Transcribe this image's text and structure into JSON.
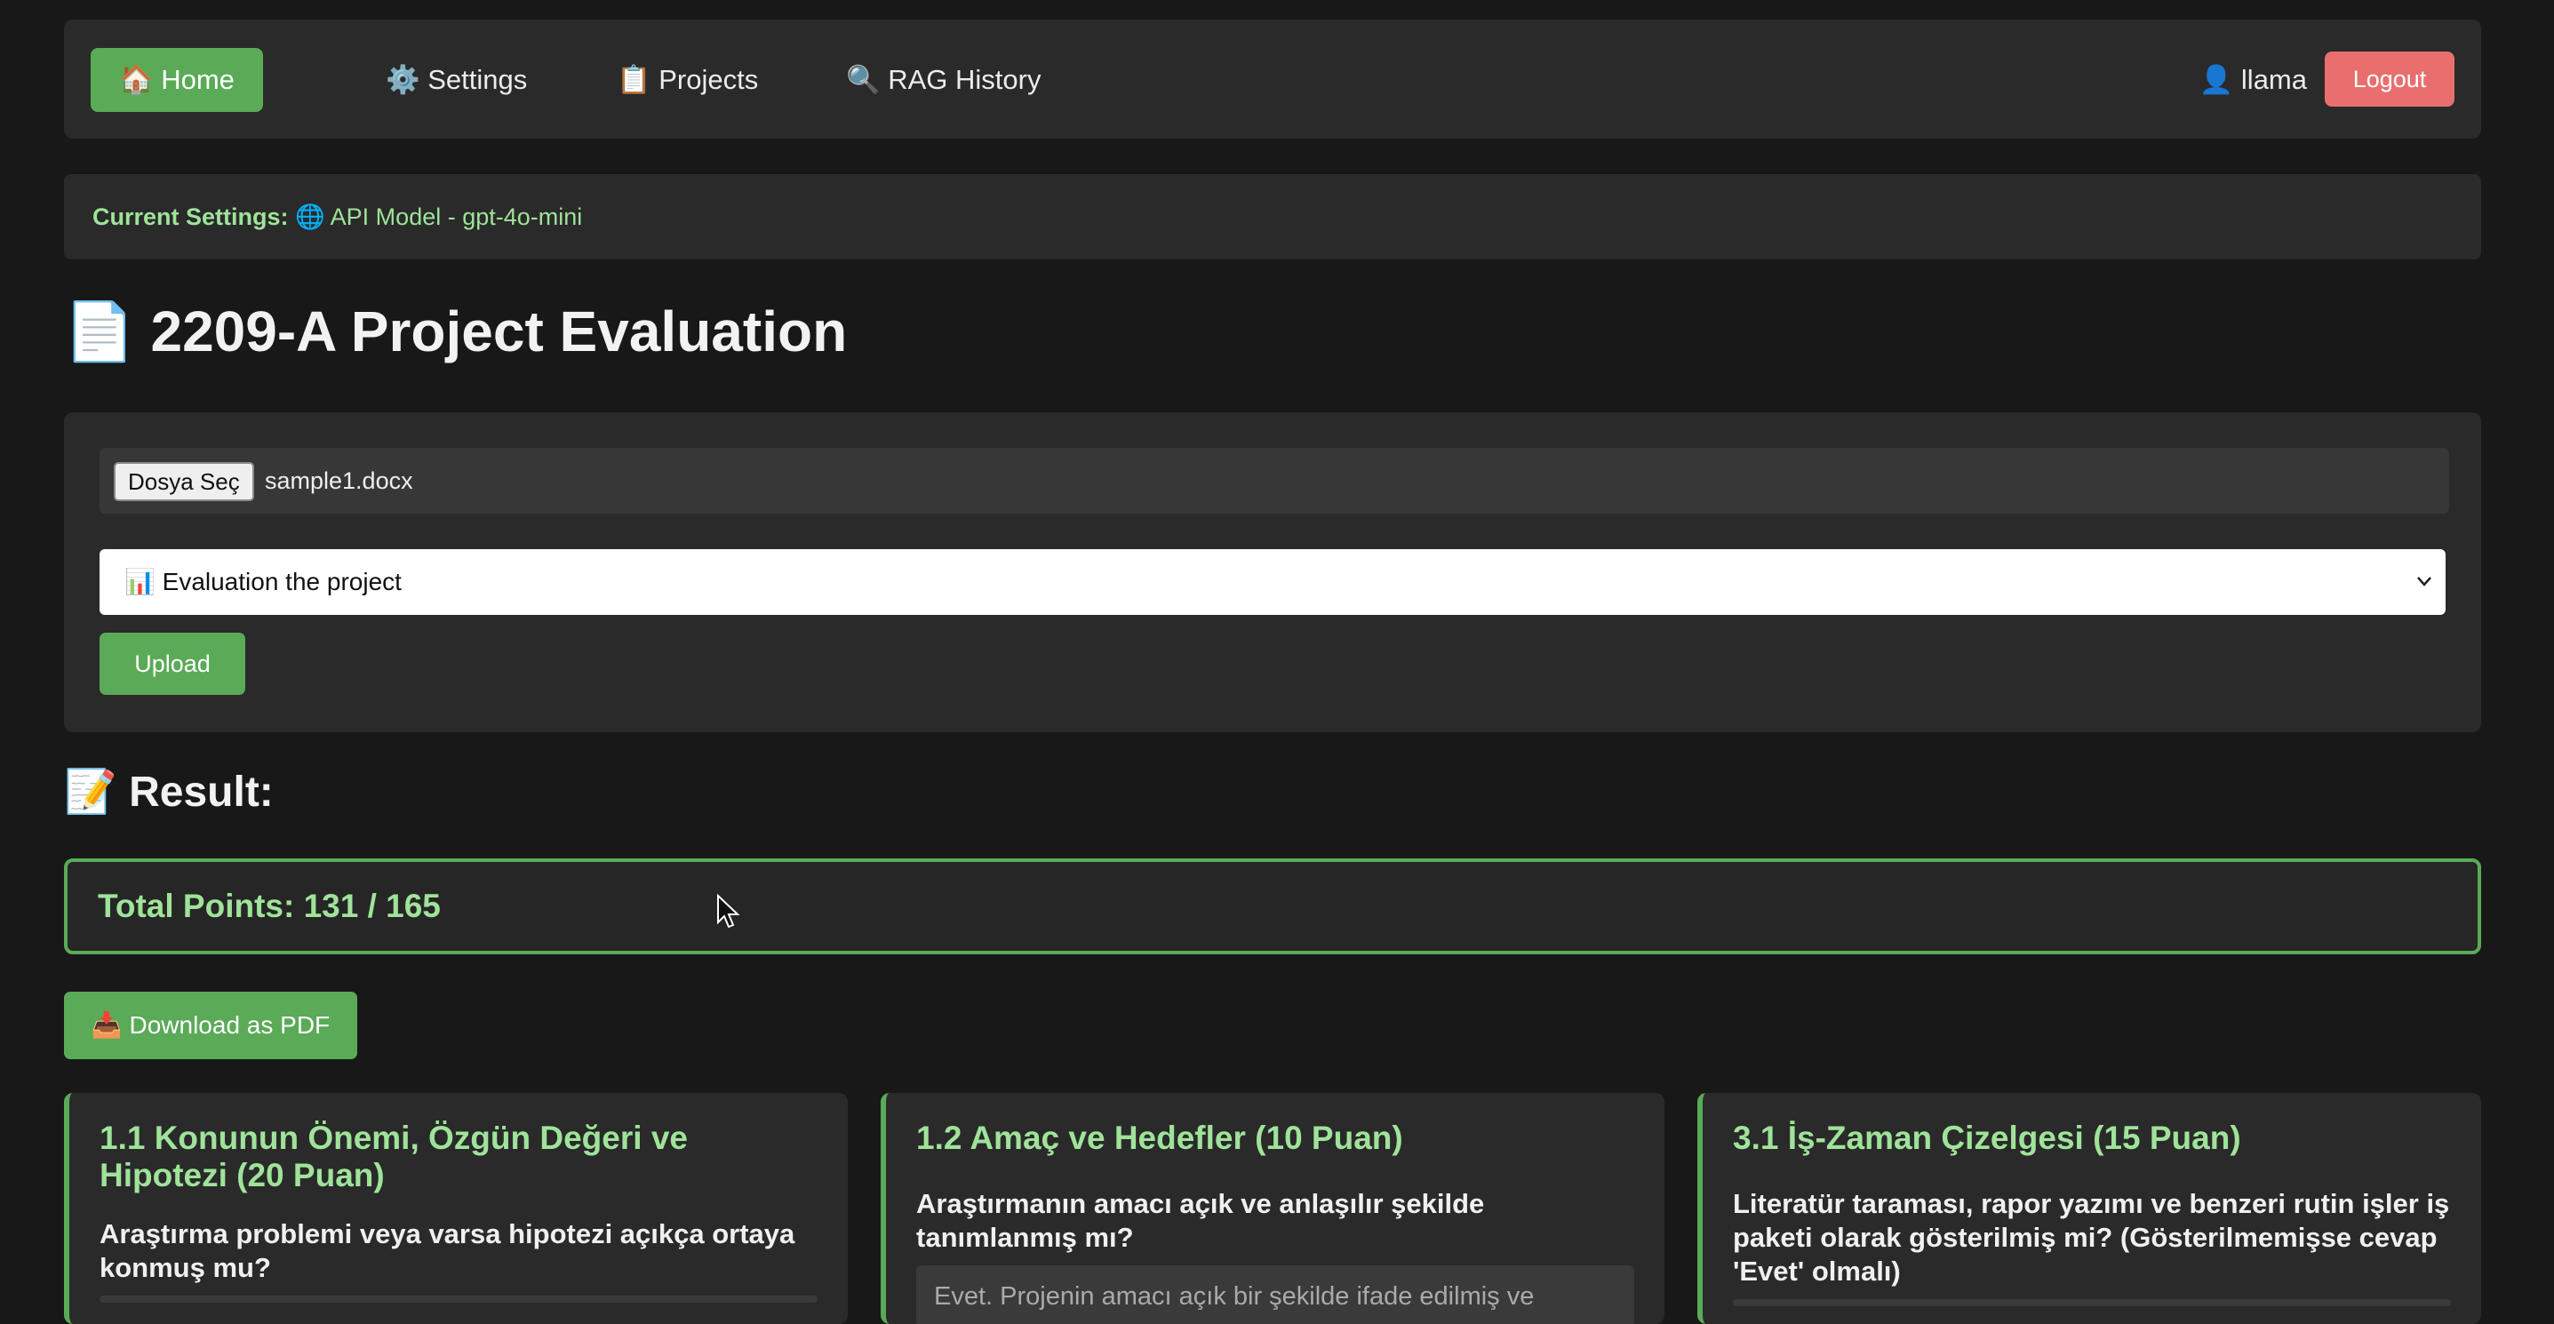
{
  "nav": {
    "home": "🏠 Home",
    "settings": "⚙️ Settings",
    "projects": "📋 Projects",
    "rag_history": "🔍 RAG History",
    "user": "👤 llama",
    "logout": "Logout"
  },
  "settings_bar": {
    "label": "Current Settings:",
    "value": "🌐 API Model - gpt-4o-mini"
  },
  "page_title": "📄 2209-A Project Evaluation",
  "upload": {
    "file_button": "Dosya Seç",
    "file_name": "sample1.docx",
    "select_value": "📊 Evaluation the project",
    "upload_label": "Upload"
  },
  "result": {
    "heading": "📝 Result:",
    "total_points": "Total Points: 131 / 165",
    "download_pdf": "📥 Download as PDF"
  },
  "cards": [
    {
      "title": "1.1 Konunun Önemi, Özgün Değeri ve Hipotezi (20 Puan)",
      "question": "Araştırma problemi veya varsa hipotezi açıkça ortaya konmuş mu?",
      "answer": ""
    },
    {
      "title": "1.2 Amaç ve Hedefler (10 Puan)",
      "question": "Araştırmanın amacı açık ve anlaşılır şekilde tanımlanmış mı?",
      "answer": "Evet. Projenin amacı açık bir şekilde ifade edilmiş ve"
    },
    {
      "title": "3.1 İş-Zaman Çizelgesi (15 Puan)",
      "question": "Literatür taraması, rapor yazımı ve benzeri rutin işler iş paketi olarak gösterilmiş mi? (Gösterilmemişse cevap 'Evet' olmalı)",
      "answer": ""
    }
  ],
  "colors": {
    "accent_green": "#5aaa57",
    "logout_red": "#e96f6f",
    "text_green": "#9fe39a",
    "background": "#181818",
    "panel": "#2a2a2a"
  }
}
